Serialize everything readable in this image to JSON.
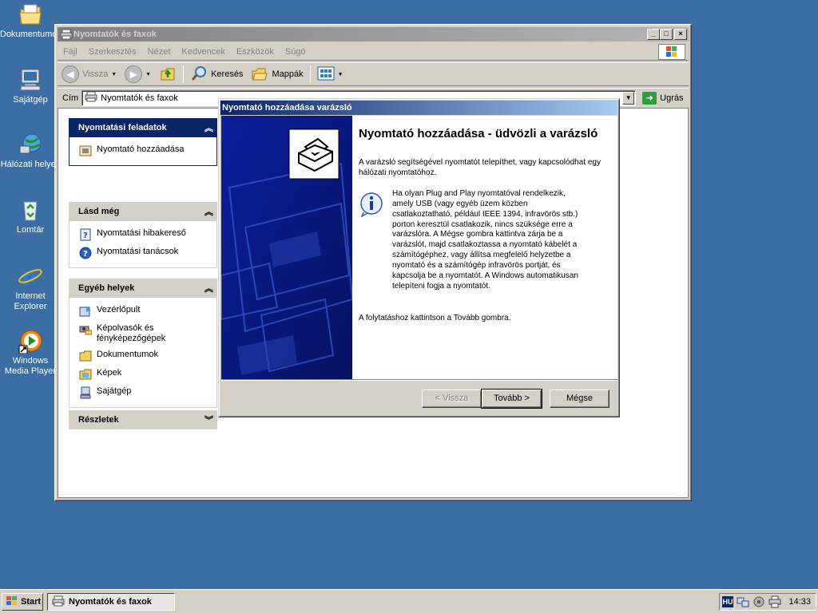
{
  "desktop": {
    "icons": [
      {
        "label": "Dokumentumok",
        "icon": "my-documents-icon"
      },
      {
        "label": "Sajátgép",
        "icon": "my-computer-icon"
      },
      {
        "label": "Hálózati helyek",
        "icon": "network-places-icon"
      },
      {
        "label": "Lomtár",
        "icon": "recycle-bin-icon"
      },
      {
        "label": "Internet Explorer",
        "icon": "internet-explorer-icon"
      },
      {
        "label": "Windows Media Player",
        "icon": "media-player-icon"
      }
    ]
  },
  "window": {
    "title": "Nyomtatók és faxok",
    "buttons": {
      "minimize": "_",
      "maximize": "□",
      "close": "×"
    },
    "menu": [
      "Fájl",
      "Szerkesztés",
      "Nézet",
      "Kedvencek",
      "Eszközök",
      "Súgó"
    ],
    "toolbar": {
      "back": "Vissza",
      "search": "Keresés",
      "folders": "Mappák"
    },
    "address": {
      "label": "Cím",
      "value": "Nyomtatók és faxok",
      "go": "Ugrás"
    }
  },
  "taskpane": {
    "printer_tasks": {
      "title": "Nyomtatási feladatok",
      "items": [
        "Nyomtató hozzáadása"
      ]
    },
    "see_also": {
      "title": "Lásd még",
      "items": [
        "Nyomtatási hibakereső",
        "Nyomtatási tanácsok"
      ]
    },
    "other_places": {
      "title": "Egyéb helyek",
      "items": [
        "Vezérlőpult",
        "Képolvasók és fényképezőgépek",
        "Dokumentumok",
        "Képek",
        "Sajátgép"
      ]
    },
    "details": {
      "title": "Részletek"
    }
  },
  "dialog": {
    "title": "Nyomtató hozzáadása varázsló",
    "heading": "Nyomtató hozzáadása - üdvözli a varázsló",
    "intro": "A varázsló segítségével nyomtatót telepíthet, vagy kapcsolódhat egy hálózati nyomtatóhoz.",
    "info": "Ha olyan Plug and Play nyomtatóval rendelkezik, amely USB (vagy egyéb üzem közben csatlakoztatható, például IEEE 1394, infravörös stb.) porton keresztül csatlakozik, nincs szüksége erre a varázslóra. A Mégse gombra kattintva zárja be a varázslót, majd csatlakoztassa a nyomtató kábelét a számítógéphez, vagy állítsa megfelelő helyzetbe a nyomtató és a számítógép infravörös portját, és kapcsolja be a nyomtatót. A Windows automatikusan telepíteni fogja a nyomtatót.",
    "continue": "A folytatáshoz kattintson a Tovább gombra.",
    "buttons": {
      "back": "< Vissza",
      "next": "Tovább >",
      "cancel": "Mégse"
    }
  },
  "taskbar": {
    "start": "Start",
    "task": "Nyomtatók és faxok",
    "lang": "HU",
    "clock": "14:33"
  }
}
